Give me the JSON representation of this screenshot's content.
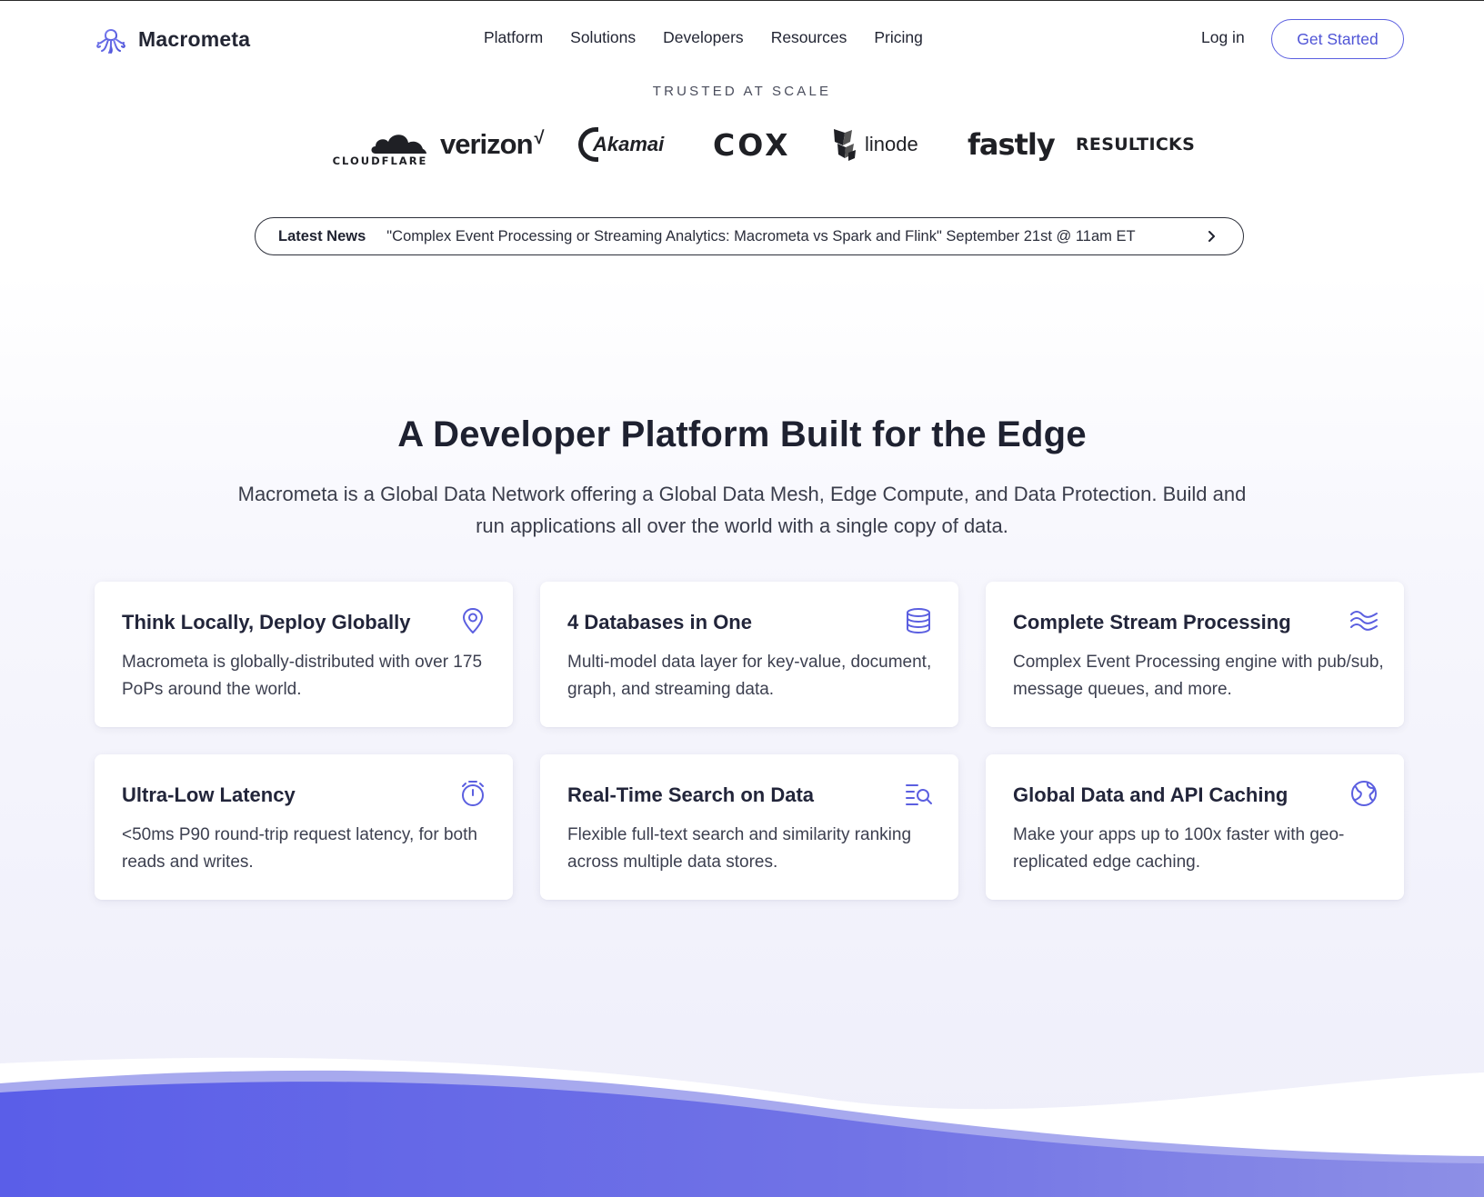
{
  "brand": {
    "name": "Macrometa",
    "accent": "#5b5fe0"
  },
  "nav": {
    "items": [
      {
        "label": "Platform"
      },
      {
        "label": "Solutions"
      },
      {
        "label": "Developers"
      },
      {
        "label": "Resources"
      },
      {
        "label": "Pricing"
      }
    ],
    "login_label": "Log in",
    "cta_label": "Get Started"
  },
  "trusted": {
    "title": "TRUSTED AT SCALE",
    "logos": [
      {
        "name": "CLOUDFLARE"
      },
      {
        "name": "verizon"
      },
      {
        "name": "Akamai"
      },
      {
        "name": "COX"
      },
      {
        "name": "linode"
      },
      {
        "name": "fastly"
      },
      {
        "name": "RESULTICKS"
      }
    ]
  },
  "news": {
    "label": "Latest News",
    "text": "\"Complex Event Processing or Streaming Analytics: Macrometa vs Spark and Flink\" September 21st @ 11am ET"
  },
  "section": {
    "headline": "A Developer Platform Built for the Edge",
    "subheadline": "Macrometa is a Global Data Network offering a Global Data Mesh, Edge Compute, and Data Protection. Build and run applications all over the world with a single copy of data."
  },
  "features": [
    {
      "title": "Think Locally, Deploy Globally",
      "body": "Macrometa is globally-distributed with over 175 PoPs around the world.",
      "icon": "map-pin-icon"
    },
    {
      "title": "4 Databases in One",
      "body": "Multi-model data layer for key-value, document, graph, and streaming data.",
      "icon": "database-icon"
    },
    {
      "title": "Complete Stream Processing",
      "body": "Complex Event Processing engine with pub/sub, message queues, and more.",
      "icon": "waves-icon"
    },
    {
      "title": "Ultra-Low Latency",
      "body": "<50ms P90 round-trip request latency, for both reads and writes.",
      "icon": "stopwatch-icon"
    },
    {
      "title": "Real-Time Search on Data",
      "body": "Flexible full-text search and similarity ranking across multiple data stores.",
      "icon": "search-list-icon"
    },
    {
      "title": "Global Data and API Caching",
      "body": "Make your apps up to 100x faster with geo-replicated edge caching.",
      "icon": "globe-icon"
    }
  ]
}
